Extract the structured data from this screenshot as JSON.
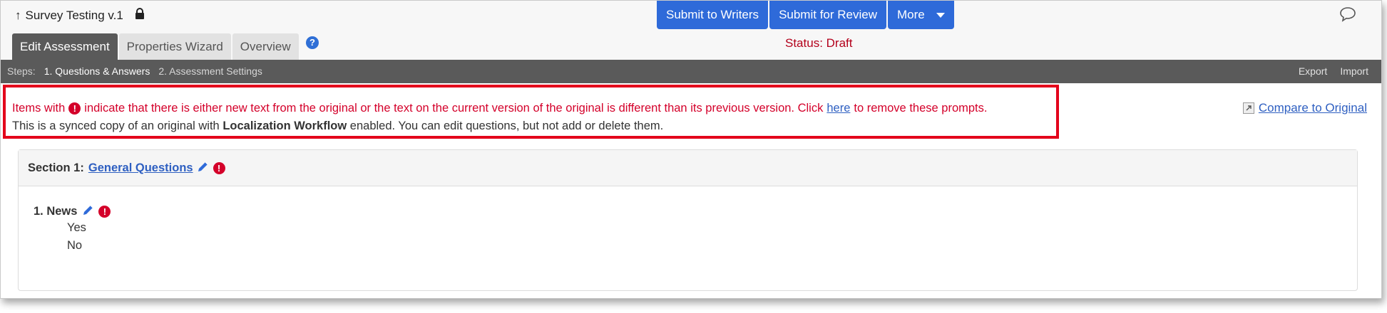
{
  "app": {
    "title_arrow": "↑",
    "title": "Survey Testing v.1"
  },
  "tabs": [
    {
      "label": "Edit Assessment",
      "active": true
    },
    {
      "label": "Properties Wizard",
      "active": false
    },
    {
      "label": "Overview",
      "active": false
    }
  ],
  "actions": {
    "submit_writers": "Submit to Writers",
    "submit_review": "Submit for Review",
    "more": "More"
  },
  "status": "Status: Draft",
  "steps": {
    "label": "Steps:",
    "step1": "1. Questions & Answers",
    "step2": "2. Assessment Settings",
    "export": "Export",
    "import": "Import"
  },
  "notice": {
    "line1_prefix": "Items with",
    "line1_middle": "indicate that there is either new text from the original or the text on the current version of the original is different than its previous version. Click",
    "link": "here",
    "line1_suffix": "to remove these prompts.",
    "line2_prefix": "This is a synced copy of an original with",
    "line2_bold": "Localization Workflow",
    "line2_suffix": "enabled. You can edit questions, but not add or delete them."
  },
  "compare_label": "Compare to Original",
  "section": {
    "prefix": "Section 1:",
    "name": "General Questions",
    "question": "1. News",
    "answers": [
      "Yes",
      "No"
    ]
  },
  "colors": {
    "accent": "#2e6ad9",
    "alert": "#d4002a",
    "status": "#b3001b",
    "steps_bar": "#5a5a5a"
  },
  "icons": [
    "lock-icon",
    "help-icon",
    "chat-icon",
    "alert-icon",
    "pencil-icon",
    "external-link-icon",
    "caret-down-icon"
  ]
}
